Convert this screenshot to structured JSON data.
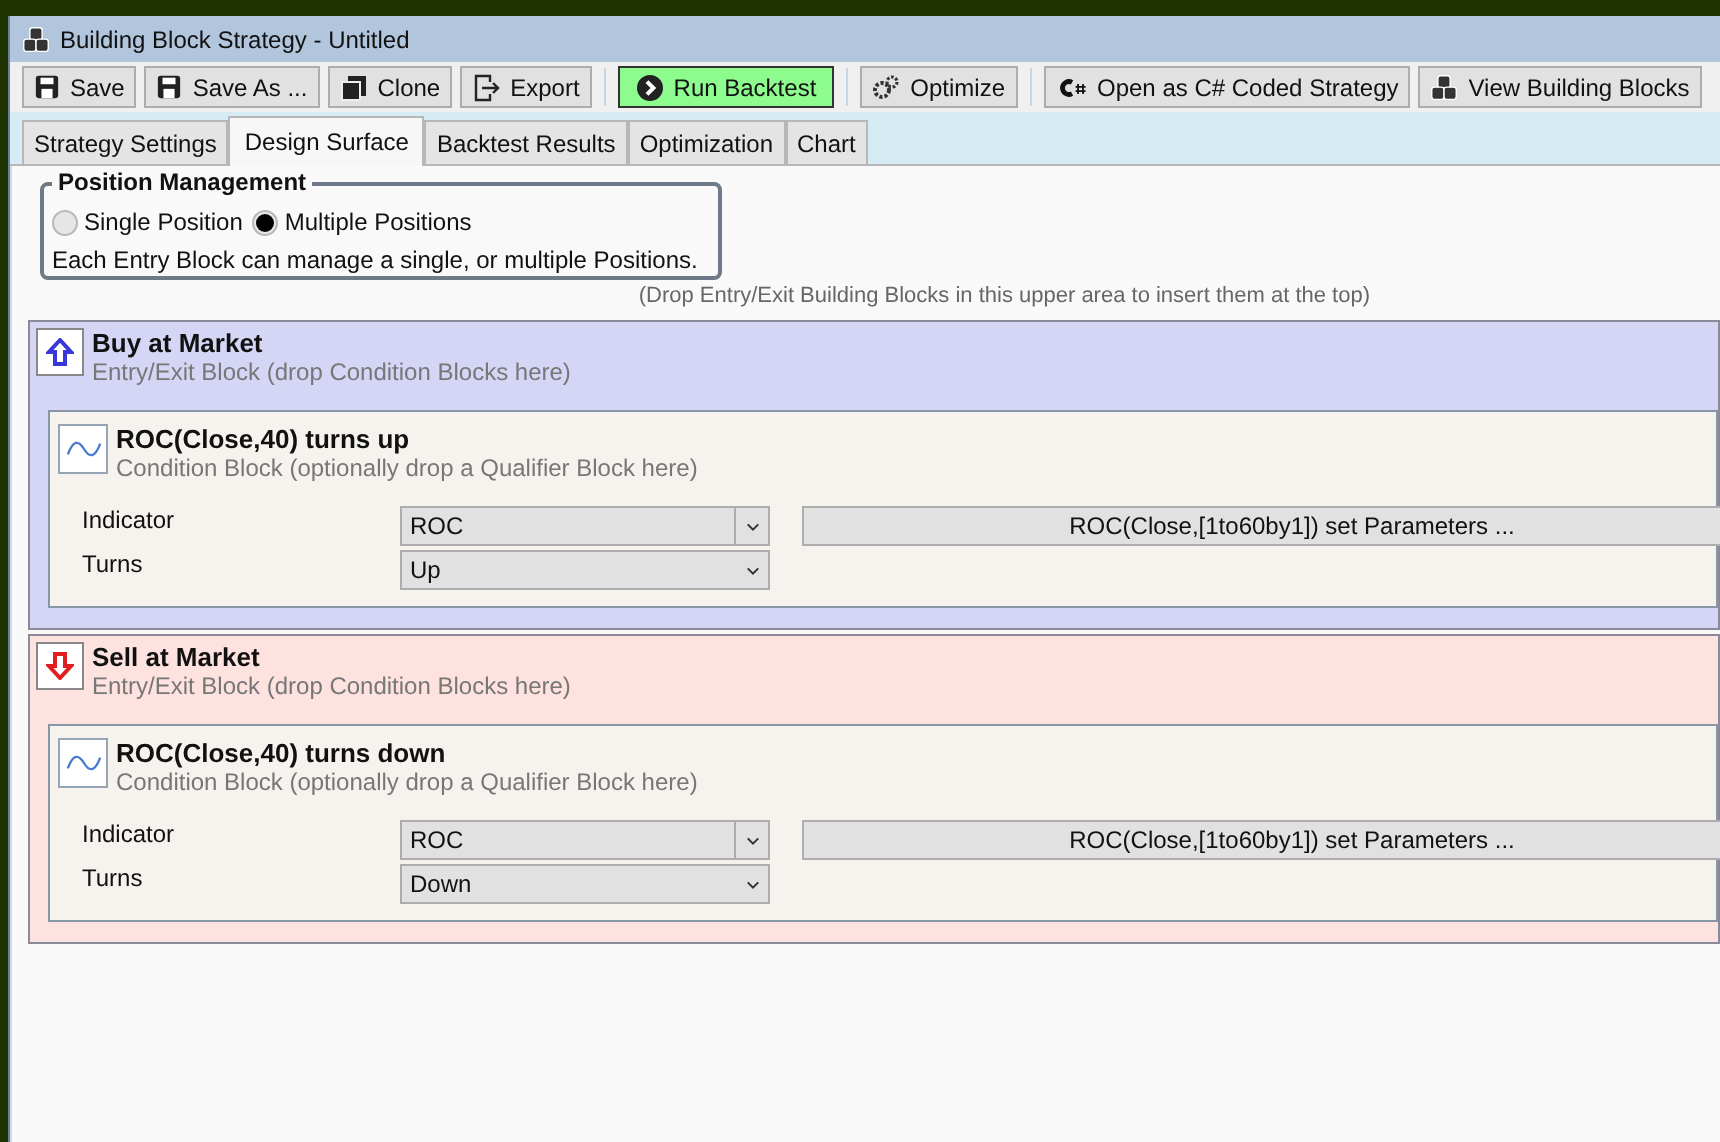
{
  "window": {
    "title": "Building Block Strategy - Untitled"
  },
  "toolbar": [
    {
      "kind": "save",
      "label": "Save",
      "highlighted": false
    },
    {
      "kind": "save",
      "label": "Save As ...",
      "highlighted": false
    },
    {
      "kind": "clone",
      "label": "Clone",
      "highlighted": false
    },
    {
      "kind": "export",
      "label": "Export",
      "highlighted": false
    },
    {
      "kind": "separator"
    },
    {
      "kind": "run",
      "label": "Run Backtest",
      "highlighted": true
    },
    {
      "kind": "separator"
    },
    {
      "kind": "optimize",
      "label": "Optimize",
      "highlighted": false
    },
    {
      "kind": "separator"
    },
    {
      "kind": "csharp",
      "label": "Open as C# Coded Strategy",
      "highlighted": false
    },
    {
      "kind": "blocks",
      "label": "View Building Blocks",
      "highlighted": false
    }
  ],
  "tabs": [
    {
      "label": "Strategy Settings",
      "selected": false
    },
    {
      "label": "Design Surface",
      "selected": true
    },
    {
      "label": "Backtest Results",
      "selected": false
    },
    {
      "label": "Optimization",
      "selected": false
    },
    {
      "label": "Chart",
      "selected": false
    }
  ],
  "position_management": {
    "title": "Position Management",
    "options": [
      {
        "label": "Single Position",
        "selected": false
      },
      {
        "label": "Multiple Positions",
        "selected": true
      }
    ],
    "note": "Each Entry Block can manage a single, or multiple Positions."
  },
  "drop_hint": "(Drop Entry/Exit Building Blocks in this upper area to insert them at the top)",
  "blocks": [
    {
      "kind": "buy",
      "title": "Buy at Market",
      "subtitle": "Entry/Exit Block (drop Condition Blocks here)",
      "conditions": [
        {
          "title": "ROC(Close,40) turns up",
          "subtitle": "Condition Block (optionally drop a Qualifier Block here)",
          "fields": [
            {
              "label": "Indicator",
              "value": "ROC",
              "button": "ROC(Close,[1to60by1]) set Parameters ..."
            },
            {
              "label": "Turns",
              "value": "Up"
            }
          ]
        }
      ]
    },
    {
      "kind": "sell",
      "title": "Sell at Market",
      "subtitle": "Entry/Exit Block (drop Condition Blocks here)",
      "conditions": [
        {
          "title": "ROC(Close,40) turns down",
          "subtitle": "Condition Block (optionally drop a Qualifier Block here)",
          "fields": [
            {
              "label": "Indicator",
              "value": "ROC",
              "button": "ROC(Close,[1to60by1]) set Parameters ..."
            },
            {
              "label": "Turns",
              "value": "Down"
            }
          ]
        }
      ]
    }
  ]
}
